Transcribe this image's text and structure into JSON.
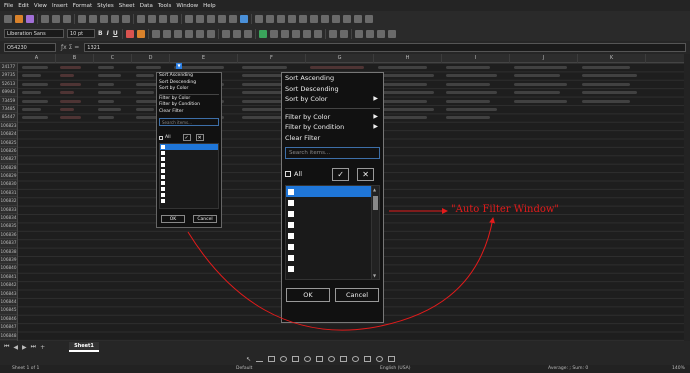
{
  "menubar": {
    "items": [
      "File",
      "Edit",
      "View",
      "Insert",
      "Format",
      "Styles",
      "Sheet",
      "Data",
      "Tools",
      "Window",
      "Help"
    ]
  },
  "font": {
    "name": "Liberation Sans",
    "size": "10 pt"
  },
  "formula": {
    "cell_ref": "O54230",
    "content": "1321"
  },
  "columns": [
    "A",
    "B",
    "C",
    "D",
    "E",
    "F",
    "G",
    "H",
    "I",
    "J",
    "K"
  ],
  "rows": [
    "24177",
    "29735",
    "52613",
    "69943",
    "73459",
    "73485",
    "85447",
    "106823",
    "106824",
    "106825",
    "106826",
    "106827",
    "106828",
    "106829",
    "106830",
    "106831",
    "106832",
    "106833",
    "106834",
    "106835",
    "106836",
    "106837",
    "106838",
    "106839",
    "106840",
    "106841",
    "106842",
    "106843",
    "106844",
    "106845",
    "106846",
    "106847",
    "106848"
  ],
  "sheet_tab": "Sheet1",
  "status": {
    "sheet": "Sheet 1 of 1",
    "style": "Default",
    "language": "English (USA)",
    "summary": "Average: ; Sum: 0",
    "zoom": "140%"
  },
  "small_filter": {
    "menu": [
      "Sort Ascending",
      "Sort Descending",
      "Sort by Color",
      "Filter by Color",
      "Filter by Condition",
      "Clear Filter"
    ],
    "search_placeholder": "Search items...",
    "all_label": "All",
    "ok": "OK",
    "cancel": "Cancel"
  },
  "big_filter": {
    "sort_ascending": "Sort Ascending",
    "sort_descending": "Sort Descending",
    "sort_by_color": "Sort by Color",
    "filter_by_color": "Filter by Color",
    "filter_by_condition": "Filter by Condition",
    "clear_filter": "Clear Filter",
    "search_placeholder": "Search items...",
    "all_label": "All",
    "ok": "OK",
    "cancel": "Cancel"
  },
  "annotation": {
    "label": "\"Auto Filter Window\""
  },
  "colors": {
    "accent": "#1f76d8",
    "annotation": "#e31b1b"
  }
}
